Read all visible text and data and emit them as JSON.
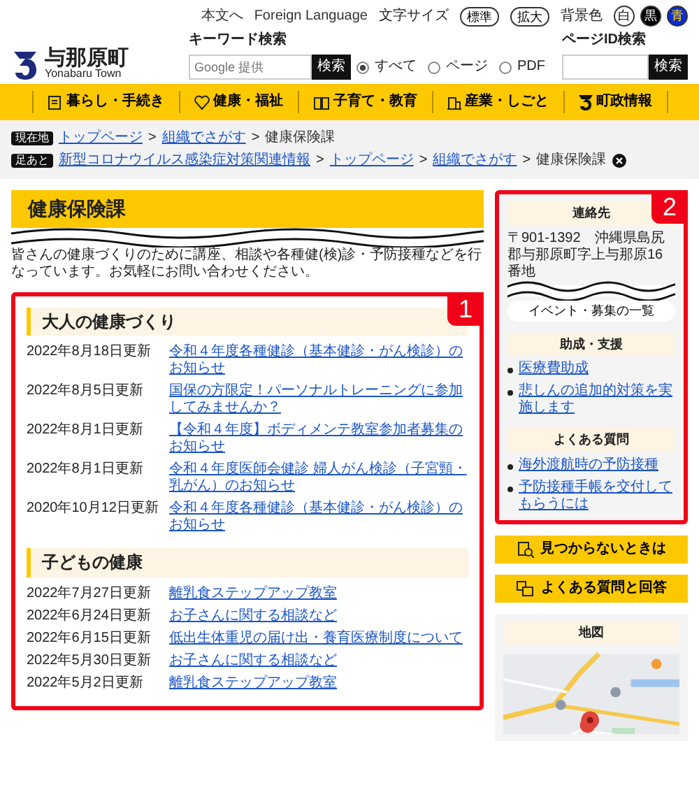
{
  "header": {
    "logo": {
      "name": "与那原町",
      "subtitle": "Yonabaru Town"
    },
    "utility_links": [
      "本文へ",
      "Foreign Language"
    ],
    "font_size": {
      "label": "文字サイズ",
      "options": [
        "標準",
        "拡大"
      ]
    },
    "background_color": {
      "label": "背景色",
      "options": [
        {
          "label": "白",
          "color": "#ffffff"
        },
        {
          "label": "黒",
          "color": "#000000"
        },
        {
          "label": "青",
          "color": "#0a2bd6"
        }
      ]
    },
    "keyword_search": {
      "label": "キーワード検索",
      "placeholder": "Google 提供",
      "button": "検索",
      "scopes": [
        {
          "label": "すべて",
          "selected": true
        },
        {
          "label": "ページ",
          "selected": false
        },
        {
          "label": "PDF",
          "selected": false
        }
      ]
    },
    "page_id_search": {
      "label": "ページID検索",
      "button": "検索"
    }
  },
  "nav": [
    {
      "label": "暮らし・手続き"
    },
    {
      "label": "健康・福祉"
    },
    {
      "label": "子育て・教育"
    },
    {
      "label": "産業・しごと"
    },
    {
      "label": "町政情報"
    }
  ],
  "breadcrumbs": [
    {
      "tag": "現在地",
      "closable": false,
      "separator": ">",
      "items": [
        {
          "label": "トップページ",
          "link": true
        },
        {
          "label": "組織でさがす",
          "link": true
        },
        {
          "label": "健康保険課",
          "link": false
        }
      ]
    },
    {
      "tag": "足あと",
      "closable": true,
      "separator": ">",
      "items": [
        {
          "label": "新型コロナウイルス感染症対策関連情報",
          "link": true
        },
        {
          "label": "トップページ",
          "link": true
        },
        {
          "label": "組織でさがす",
          "link": true
        },
        {
          "label": "健康保険課",
          "link": false
        }
      ]
    }
  ],
  "page_title": "健康保険課",
  "description": "皆さんの健康づくりのために講座、相談や各種健(検)診・予防接種などを行なっています。お気軽にお問い合わせください。",
  "main_annotation": "1",
  "sections": [
    {
      "heading": "大人の健康づくり",
      "items": [
        {
          "date": "2022年8月18日更新",
          "title": "令和４年度各種健診（基本健診・がん検診）のお知らせ"
        },
        {
          "date": "2022年8月5日更新",
          "title": "国保の方限定！パーソナルトレーニングに参加してみませんか？"
        },
        {
          "date": "2022年8月1日更新",
          "title": "【令和４年度】ボディメンテ教室参加者募集のお知らせ"
        },
        {
          "date": "2022年8月1日更新",
          "title": "令和４年度医師会健診 婦人がん検診（子宮頸・乳がん）のお知らせ"
        },
        {
          "date": "2020年10月12日更新",
          "title": "令和４年度各種健診（基本健診・がん検診）のお知らせ"
        }
      ]
    },
    {
      "heading": "子どもの健康",
      "items": [
        {
          "date": "2022年7月27日更新",
          "title": "離乳食ステップアップ教室"
        },
        {
          "date": "2022年6月24日更新",
          "title": "お子さんに関する相談など"
        },
        {
          "date": "2022年6月15日更新",
          "title": "低出生体重児の届け出・養育医療制度について"
        },
        {
          "date": "2022年5月30日更新",
          "title": "お子さんに関する相談など"
        },
        {
          "date": "2022年5月2日更新",
          "title": "離乳食ステップアップ教室"
        }
      ]
    }
  ],
  "sidebar": {
    "annotation": "2",
    "contact": {
      "heading": "連絡先",
      "address": "〒901-1392　沖縄県島尻郡与那原町字上与那原16番地"
    },
    "event_button": "イベント・募集の一覧",
    "groups": [
      {
        "heading": "助成・支援",
        "links": [
          "医療費助成",
          "悲しんの追加的対策を実施します"
        ]
      },
      {
        "heading": "よくある質問",
        "links": [
          "海外渡航時の予防接種",
          "予防接種手帳を交付してもらうには"
        ]
      }
    ],
    "buttons": [
      {
        "label": "見つからないときは"
      },
      {
        "label": "よくある質問と回答"
      }
    ],
    "map": {
      "heading": "地図",
      "kind": "picture"
    }
  }
}
